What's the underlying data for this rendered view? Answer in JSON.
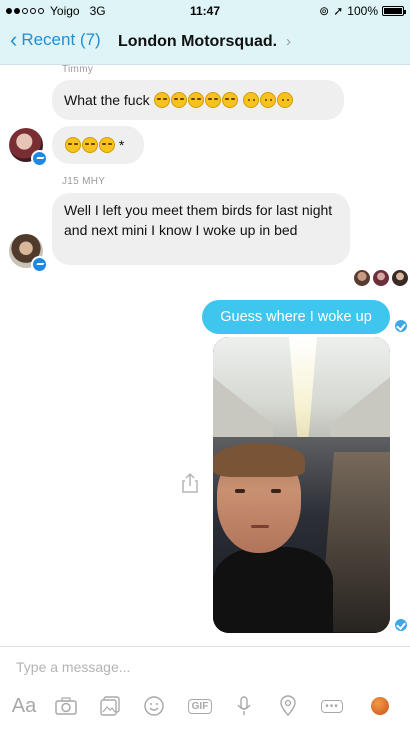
{
  "status_bar": {
    "carrier": "Yoigo",
    "network": "3G",
    "time": "11:47",
    "battery": "100%"
  },
  "nav": {
    "back_label": "Recent (7)",
    "title": "London Motorsquad."
  },
  "messages": [
    {
      "sender": "Timmy",
      "text": "What the fuck",
      "emoji_count": 8
    },
    {
      "text": "*",
      "emoji_count": 3
    },
    {
      "sender": "J15 MHY",
      "text": "Well I left you meet them birds for last night and next mini I know I woke up in bed"
    },
    {
      "outgoing": true,
      "text": "Guess where I woke up"
    }
  ],
  "composer": {
    "placeholder": "Type a message...",
    "aa_label": "Aa",
    "gif_label": "GIF"
  },
  "icons": [
    "camera-icon",
    "photo-icon",
    "emoji-icon",
    "gif-icon",
    "mic-icon",
    "location-icon",
    "more-icon",
    "basketball-icon",
    "share-icon"
  ],
  "colors": {
    "outgoing_bubble": "#3ec6ee",
    "incoming_bubble": "#efefef",
    "accent": "#1e90d8"
  }
}
